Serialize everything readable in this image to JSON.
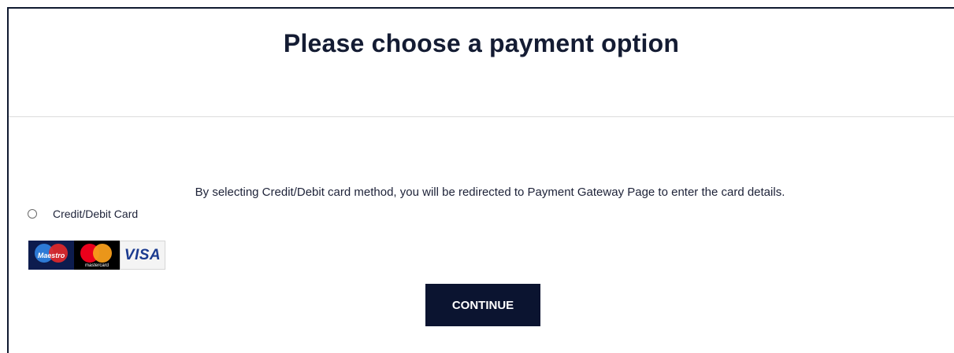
{
  "header": {
    "title": "Please choose a payment option"
  },
  "notice": {
    "text": "By selecting Credit/Debit card method, you will be redirected to Payment Gateway Page to enter the card details."
  },
  "payment_option": {
    "label": "Credit/Debit Card",
    "selected": false
  },
  "cards": {
    "maestro": "Maestro",
    "mastercard": "mastercard",
    "visa": "VISA"
  },
  "actions": {
    "continue_label": "CONTINUE"
  },
  "colors": {
    "primary_dark": "#0b1430",
    "text": "#1d2238"
  }
}
